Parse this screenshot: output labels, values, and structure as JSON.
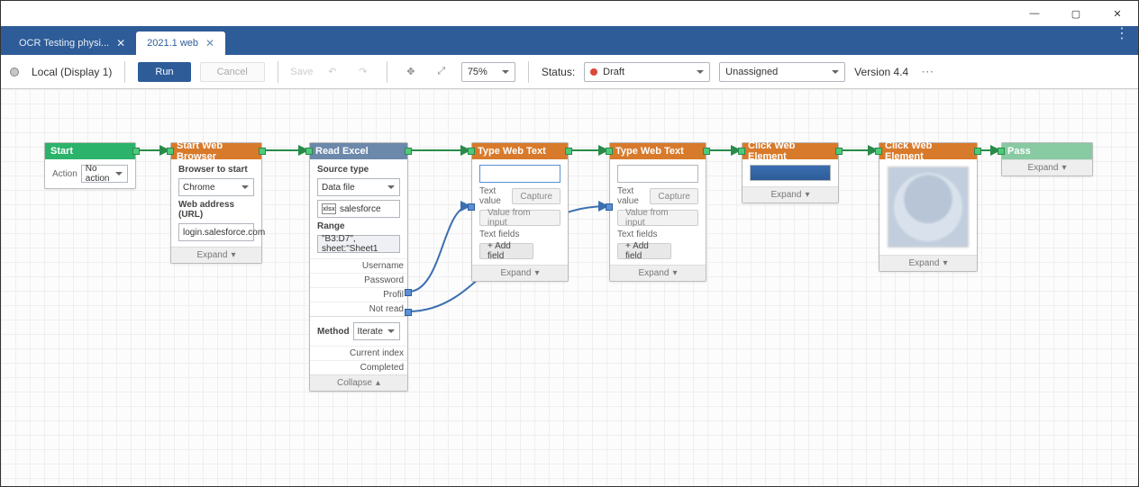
{
  "window_controls": {
    "min": "—",
    "max": "▢",
    "close": "✕"
  },
  "tabs": [
    {
      "label": "OCR Testing physi...",
      "active": false
    },
    {
      "label": "2021.1 web",
      "active": true
    }
  ],
  "toolbar": {
    "display": "Local (Display 1)",
    "run": "Run",
    "cancel": "Cancel",
    "save": "Save",
    "zoom": "75%",
    "status_label": "Status:",
    "status_value": "Draft",
    "assignee": "Unassigned",
    "version": "Version 4.4"
  },
  "expand_label": "Expand",
  "collapse_label": "Collapse",
  "value_from_input": "Value from input",
  "nodes": {
    "start": {
      "title": "Start",
      "action_label": "Action",
      "action_value": "No action"
    },
    "browser": {
      "title": "Start Web Browser",
      "browser_label": "Browser to start",
      "browser_value": "Chrome",
      "url_label": "Web address (URL)",
      "url_value": "login.salesforce.com"
    },
    "excel": {
      "title": "Read Excel",
      "source_label": "Source type",
      "source_value": "Data file",
      "file_value": "salesforce",
      "range_label": "Range",
      "range_value": "\"B3:D7\", sheet:\"Sheet1",
      "outputs": [
        "Username",
        "Password",
        "Profil",
        "Not read"
      ],
      "method_label": "Method",
      "method_value": "Iterate",
      "extra": [
        "Current index",
        "Completed"
      ]
    },
    "type1": {
      "title": "Type Web Text",
      "text_value_label": "Text value",
      "capture": "Capture",
      "text_fields_label": "Text fields",
      "add_field": "+  Add field"
    },
    "type2": {
      "title": "Type Web Text",
      "text_value_label": "Text value",
      "capture": "Capture",
      "text_fields_label": "Text fields",
      "add_field": "+  Add field"
    },
    "click1": {
      "title": "Click Web Element"
    },
    "click2": {
      "title": "Click Web Element"
    },
    "pass": {
      "title": "Pass"
    }
  }
}
